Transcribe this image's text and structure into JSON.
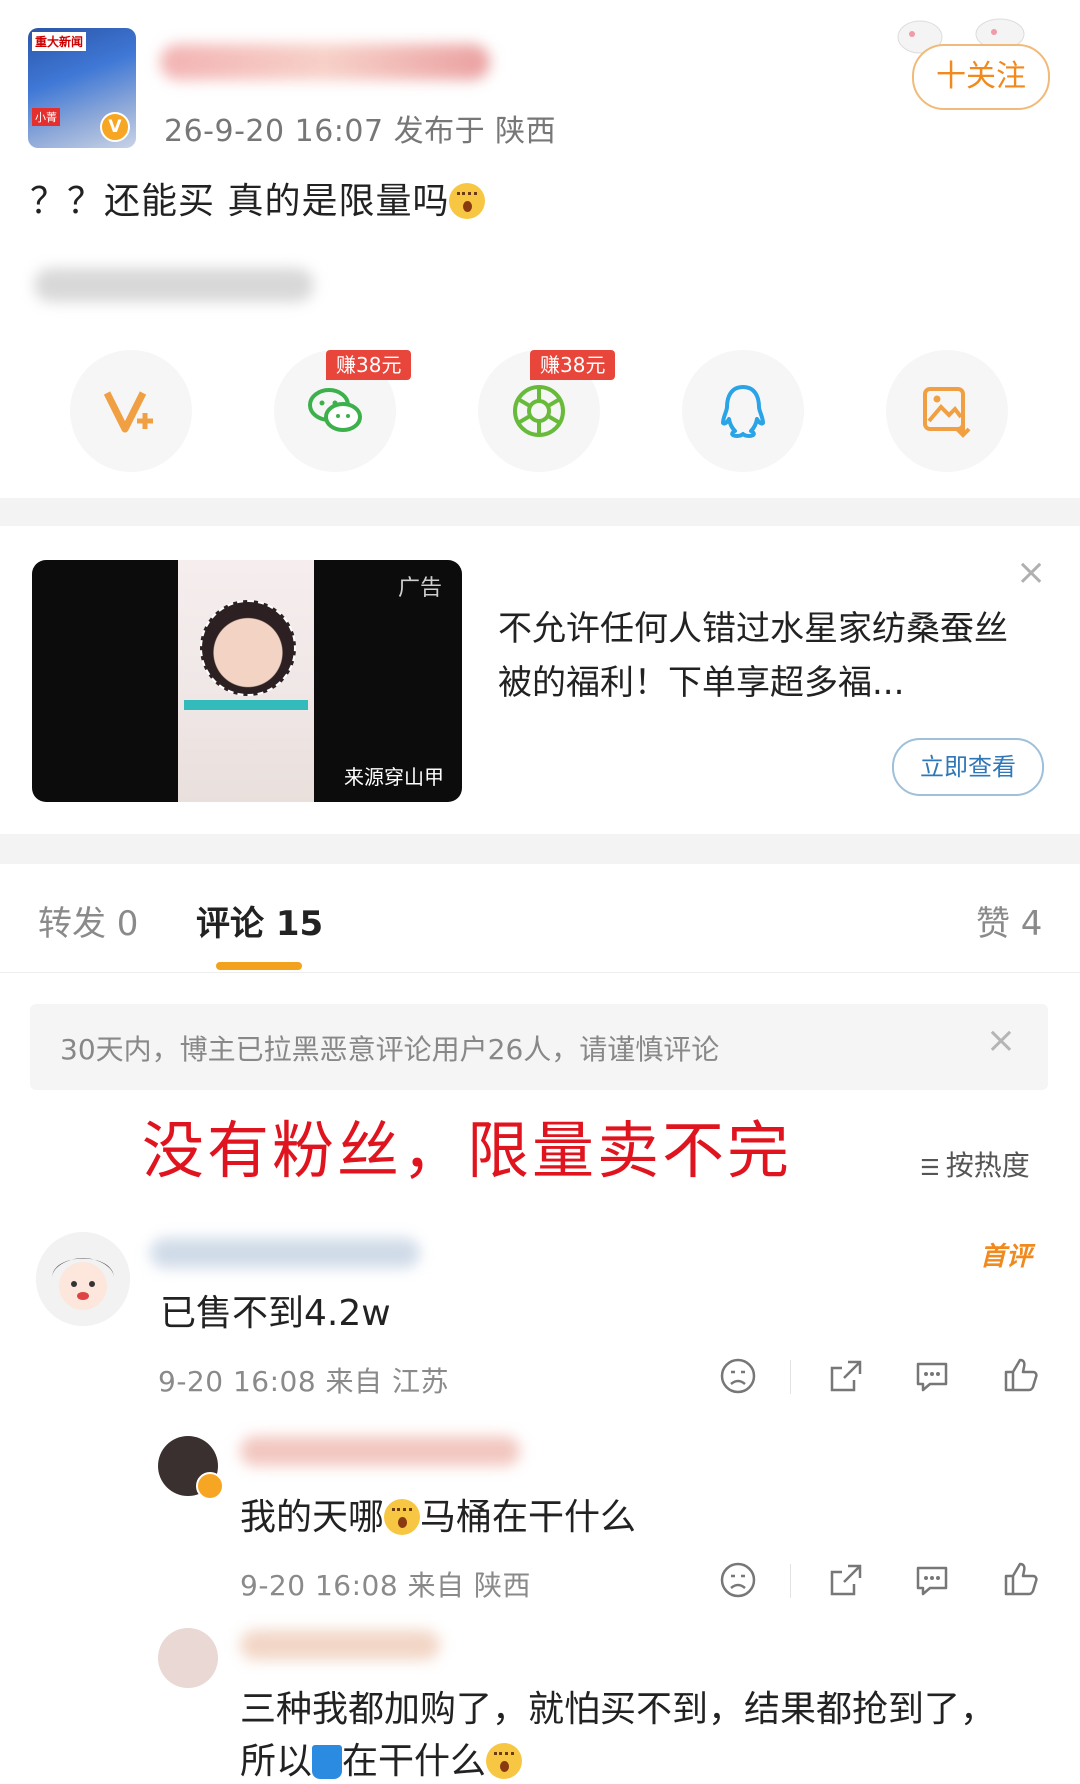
{
  "post": {
    "meta": "26-9-20 16:07  发布于 陕西",
    "follow_label": "十关注",
    "text": "？？还能买  真的是限量吗",
    "avatar_tag_top": "重大新闻",
    "avatar_tag_bottom": "小菁",
    "verified_mark": "V"
  },
  "share": {
    "earn_wechat": "赚38元",
    "earn_moments": "赚38元",
    "icons": [
      "v-plus-icon",
      "wechat-icon",
      "moments-icon",
      "qq-icon",
      "save-image-icon"
    ]
  },
  "ad": {
    "label": "广告",
    "source": "来源穿山甲",
    "title": "不允许任何人错过水星家纺桑蚕丝被的福利！下单享超多福...",
    "cta": "立即查看",
    "close": "×"
  },
  "tabs": {
    "repost": "转发 0",
    "comment": "评论 15",
    "like": "赞 4"
  },
  "notice": {
    "text": "30天内，博主已拉黑恶意评论用户26人，请谨慎评论",
    "close": "×"
  },
  "overlay_caption": "没有粉丝，限量卖不完",
  "sort": {
    "label": "按热度"
  },
  "comments": [
    {
      "text": "已售不到4.2w",
      "meta": "9-20 16:08  来自 江苏",
      "tag": "首评"
    },
    {
      "text": "我的天哪",
      "text_after": "马桶在干什么",
      "meta": "9-20 16:08  来自 陕西"
    },
    {
      "text": "三种我都加购了，就怕买不到，结果都抢到了，",
      "text_line2_a": "所以",
      "text_line2_b": "在干什么"
    }
  ],
  "colors": {
    "accent_orange": "#f08a1e",
    "overlay_red": "#e0141e",
    "earn_red": "#e8463b",
    "link_blue": "#2f77b7"
  }
}
